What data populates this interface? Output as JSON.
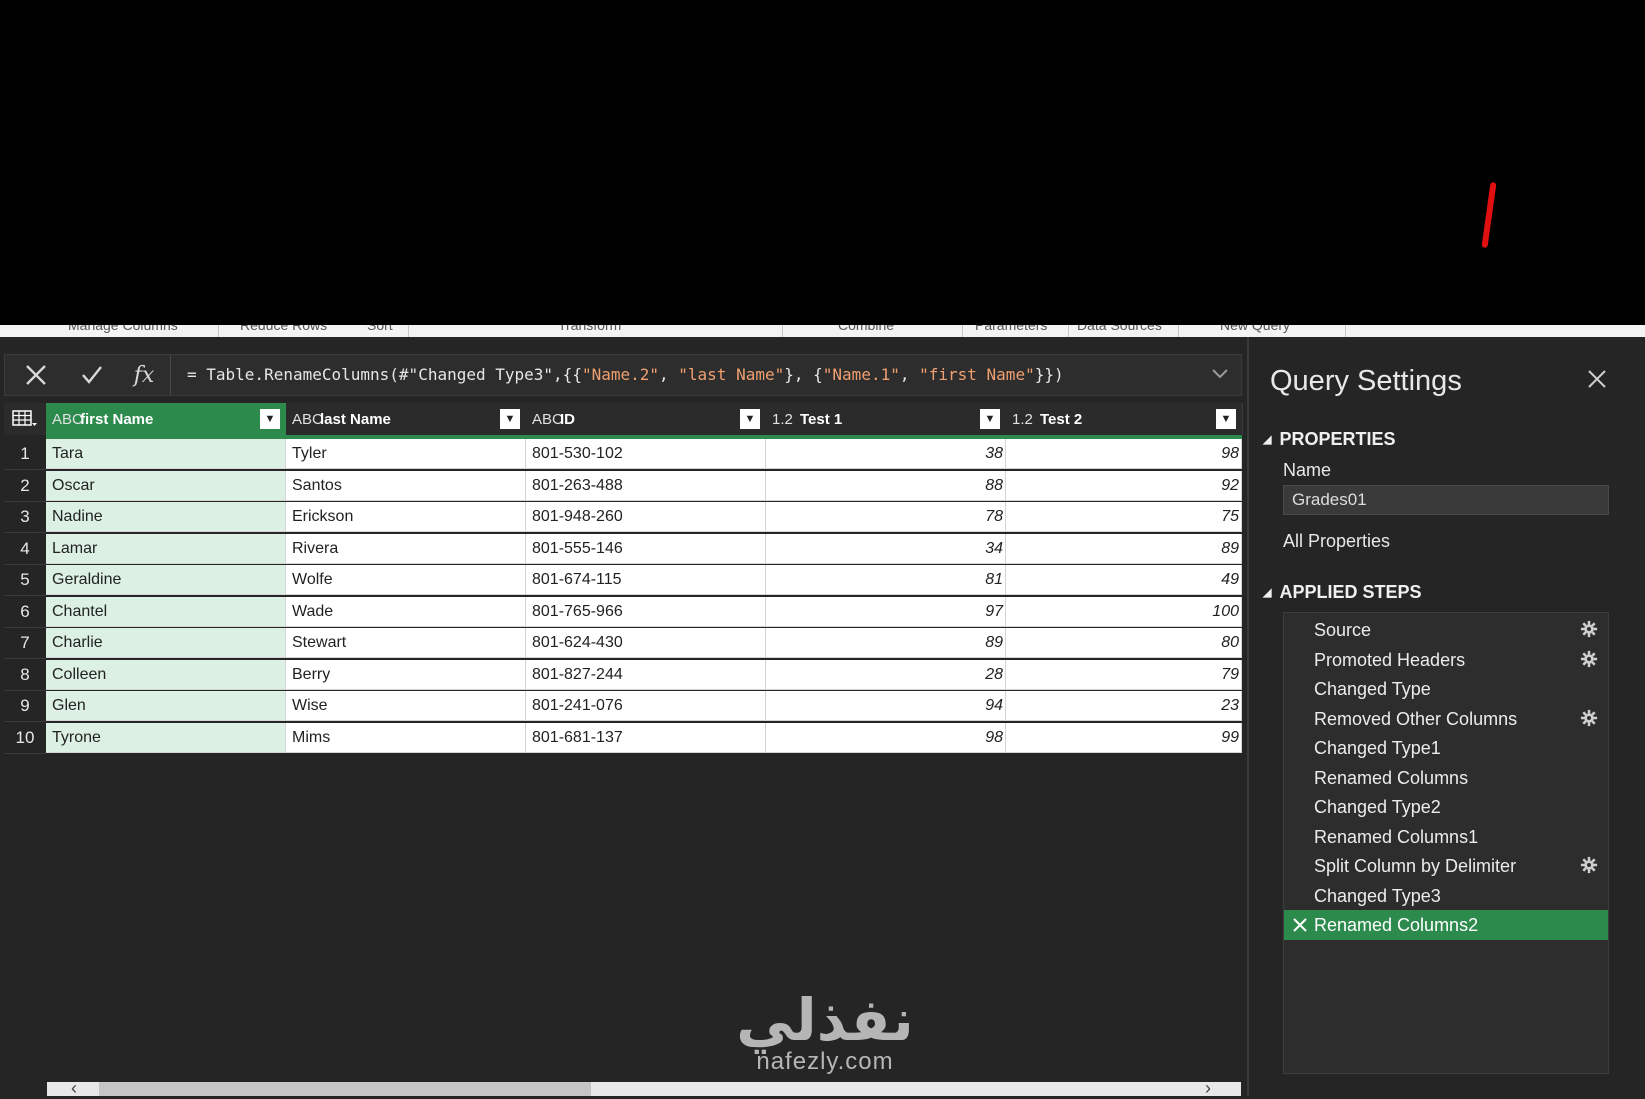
{
  "ribbon": {
    "groups": [
      "Manage Columns",
      "Reduce Rows",
      "Sort",
      "Transform",
      "Combine",
      "Parameters",
      "Data Sources",
      "New Query"
    ]
  },
  "formula_bar": {
    "cancel_icon": "close-icon",
    "commit_icon": "check-icon",
    "fx_label": "fx",
    "prefix": "= Table.RenameColumns(#\"Changed Type3\",{{",
    "s1": "\"Name.2\"",
    "c1": ", ",
    "s2": "\"last Name\"",
    "c2": "}, {",
    "s3": "\"Name.1\"",
    "c3": ", ",
    "s4": "\"first Name\"",
    "suffix": "}})"
  },
  "table": {
    "columns": [
      {
        "type": "ABC",
        "name": "first Name"
      },
      {
        "type": "ABC",
        "name": "last Name"
      },
      {
        "type": "ABC",
        "name": "ID"
      },
      {
        "type": "1.2",
        "name": "Test 1"
      },
      {
        "type": "1.2",
        "name": "Test 2"
      }
    ],
    "rows": [
      [
        "1",
        "Tara",
        "Tyler",
        "801-530-102",
        "38",
        "98"
      ],
      [
        "2",
        "Oscar",
        "Santos",
        "801-263-488",
        "88",
        "92"
      ],
      [
        "3",
        "Nadine",
        "Erickson",
        "801-948-260",
        "78",
        "75"
      ],
      [
        "4",
        "Lamar",
        "Rivera",
        "801-555-146",
        "34",
        "89"
      ],
      [
        "5",
        "Geraldine",
        "Wolfe",
        "801-674-115",
        "81",
        "49"
      ],
      [
        "6",
        "Chantel",
        "Wade",
        "801-765-966",
        "97",
        "100"
      ],
      [
        "7",
        "Charlie",
        "Stewart",
        "801-624-430",
        "89",
        "80"
      ],
      [
        "8",
        "Colleen",
        "Berry",
        "801-827-244",
        "28",
        "79"
      ],
      [
        "9",
        "Glen",
        "Wise",
        "801-241-076",
        "94",
        "23"
      ],
      [
        "10",
        "Tyrone",
        "Mims",
        "801-681-137",
        "98",
        "99"
      ]
    ]
  },
  "watermark": {
    "arabic": "نفذلي",
    "latin": "nafezly.com"
  },
  "query_settings": {
    "title": "Query Settings",
    "properties_label": "PROPERTIES",
    "name_label": "Name",
    "name_value": "Grades01",
    "all_properties": "All Properties",
    "applied_steps_label": "APPLIED STEPS",
    "steps": [
      {
        "label": "Source",
        "gear": true
      },
      {
        "label": "Promoted Headers",
        "gear": true
      },
      {
        "label": "Changed Type",
        "gear": false
      },
      {
        "label": "Removed Other Columns",
        "gear": true
      },
      {
        "label": "Changed Type1",
        "gear": false
      },
      {
        "label": "Renamed Columns",
        "gear": false
      },
      {
        "label": "Changed Type2",
        "gear": false
      },
      {
        "label": "Renamed Columns1",
        "gear": false
      },
      {
        "label": "Split Column by Delimiter",
        "gear": true
      },
      {
        "label": "Changed Type3",
        "gear": false
      },
      {
        "label": "Renamed Columns2",
        "gear": false,
        "active": true
      }
    ]
  },
  "colors": {
    "accent": "#2c8a4c",
    "selected_column_bg": "#dcf1e3",
    "string_literal": "#f0a070"
  }
}
